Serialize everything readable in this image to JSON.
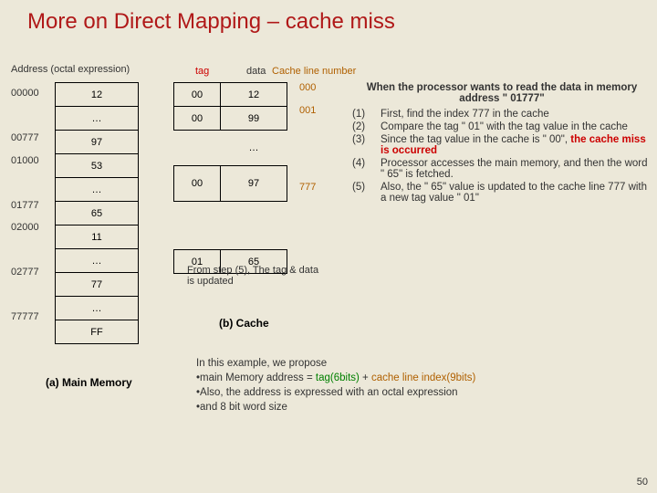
{
  "title": "More on Direct Mapping – cache miss",
  "labels": {
    "address": "Address (octal expression)",
    "tag": "tag",
    "data": "data",
    "cache_line": "Cache line number"
  },
  "mem_addrs": [
    "00000",
    "",
    "00777",
    "01000",
    "",
    "01777",
    "02000",
    "",
    "02777",
    "",
    "77777"
  ],
  "mem_values": [
    "12",
    "…",
    "97",
    "53",
    "…",
    "65",
    "11",
    "…",
    "77",
    "…",
    "FF"
  ],
  "mem_caption": "(a) Main Memory",
  "cache_rows": [
    {
      "tag": "00",
      "data": "12",
      "cln": "000",
      "h": "h"
    },
    {
      "tag": "00",
      "data": "99",
      "cln": "001",
      "h": "h"
    },
    {
      "tag": "",
      "data": "…",
      "cln": "",
      "h": "h2",
      "empty": true
    },
    {
      "tag": "00",
      "data": "97",
      "cln": "777",
      "h": "h2"
    },
    {
      "tag": "01",
      "data": "65",
      "cln": "",
      "h": "h"
    }
  ],
  "step5_note": "From step (5),\nThe tag & data is updated",
  "cache_caption": "(b) Cache",
  "explain": {
    "head": "When the processor wants to read the data in memory address \" 01777\"",
    "steps": [
      {
        "n": "(1)",
        "t": "First, find the index 777 in the cache"
      },
      {
        "n": "(2)",
        "t": "Compare the tag \" 01\" with the tag value in the cache"
      },
      {
        "n": "(3)",
        "t_pre": "Since the tag value in the cache is \" 00\", ",
        "t_strong": "the cache miss is occurred"
      },
      {
        "n": "(4)",
        "t": "Processor accesses the main memory, and then the word \" 65\" is fetched."
      },
      {
        "n": "(5)",
        "t": "Also, the \" 65\" value is updated to the cache line 777 with a new tag value \" 01\""
      }
    ]
  },
  "example": {
    "l1": "In this example, we propose",
    "l2a": "•main Memory address = ",
    "l2b_tag": "tag(6bits)",
    "l2c": " + ",
    "l2d_idx": "cache line index(9bits)",
    "l3": "•Also, the address is expressed with an octal expression",
    "l4": "•and  8 bit word size"
  },
  "page_num": "50"
}
